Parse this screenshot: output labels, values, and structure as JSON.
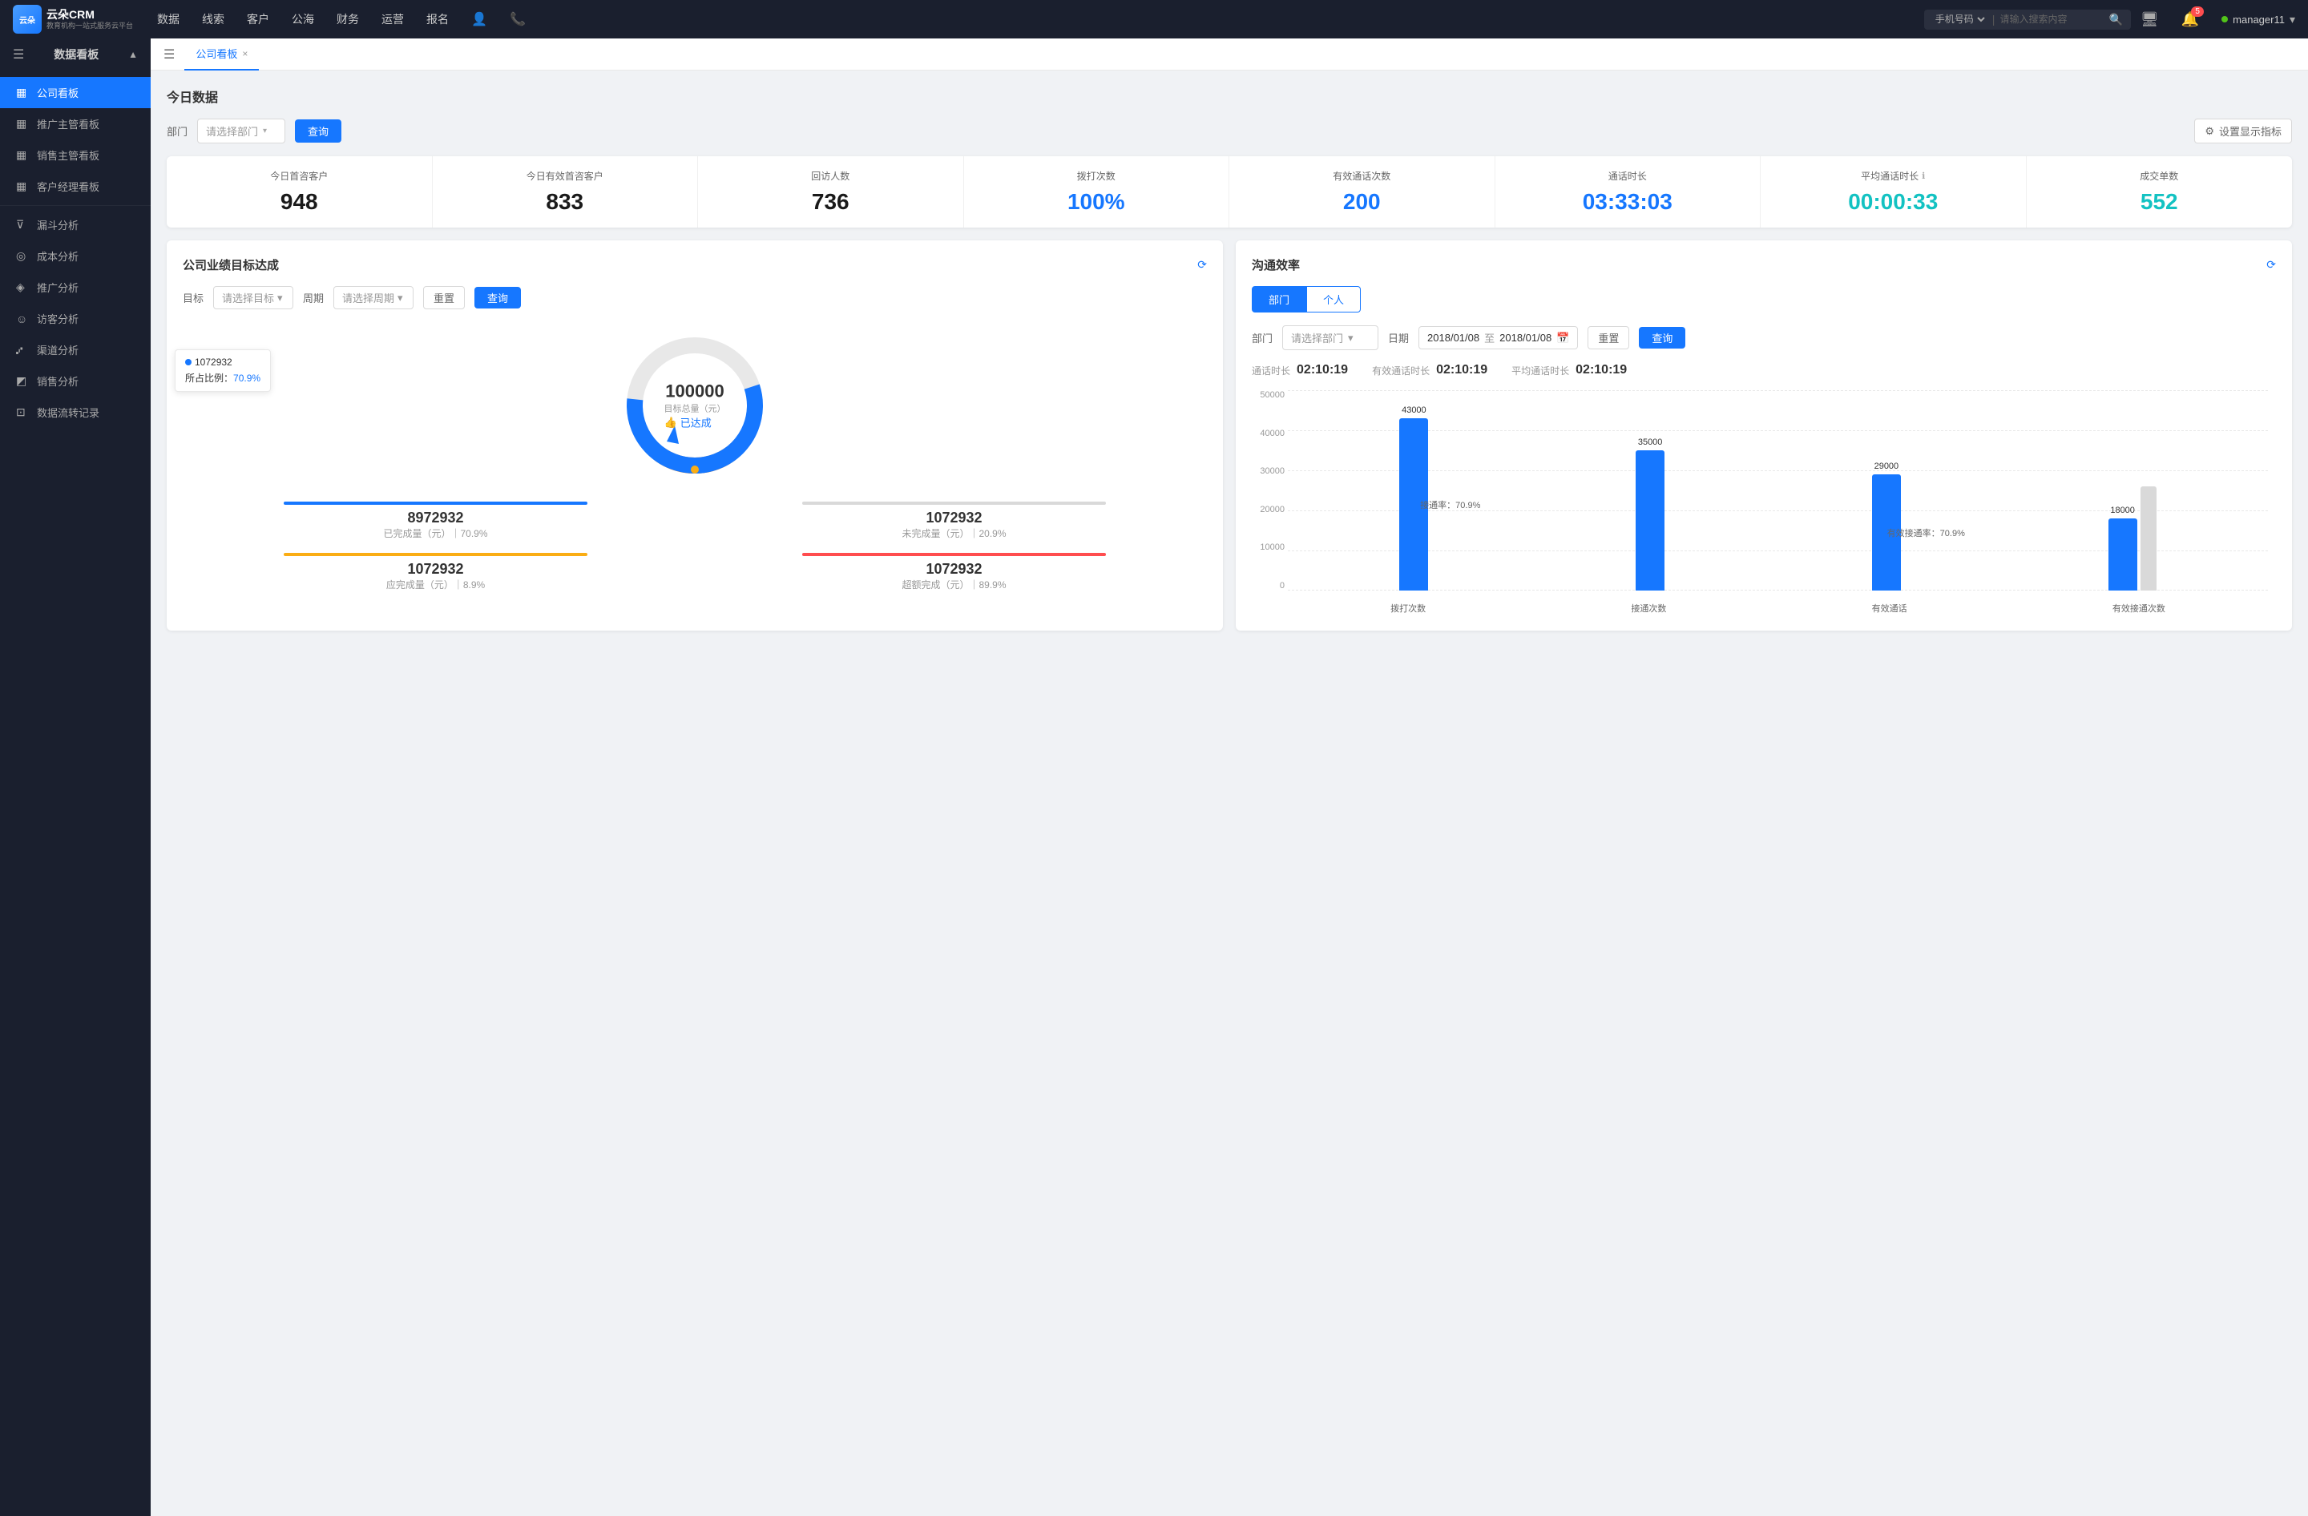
{
  "topNav": {
    "logo": {
      "brand": "云朵CRM",
      "subtitle": "教育机构一站式服务云平台"
    },
    "navItems": [
      "数据",
      "线索",
      "客户",
      "公海",
      "财务",
      "运营",
      "报名"
    ],
    "search": {
      "placeholder": "请输入搜索内容",
      "type": "手机号码"
    },
    "notificationCount": "5",
    "username": "manager11"
  },
  "sidebar": {
    "section": "数据看板",
    "items": [
      {
        "label": "公司看板",
        "active": true
      },
      {
        "label": "推广主管看板",
        "active": false
      },
      {
        "label": "销售主管看板",
        "active": false
      },
      {
        "label": "客户经理看板",
        "active": false
      },
      {
        "label": "漏斗分析",
        "active": false
      },
      {
        "label": "成本分析",
        "active": false
      },
      {
        "label": "推广分析",
        "active": false
      },
      {
        "label": "访客分析",
        "active": false
      },
      {
        "label": "渠道分析",
        "active": false
      },
      {
        "label": "销售分析",
        "active": false
      },
      {
        "label": "数据流转记录",
        "active": false
      }
    ]
  },
  "tab": {
    "label": "公司看板",
    "close": "×"
  },
  "today": {
    "title": "今日数据",
    "filter": {
      "label": "部门",
      "placeholder": "请选择部门",
      "queryBtn": "查询",
      "settingsBtn": "设置显示指标"
    },
    "stats": [
      {
        "label": "今日首咨客户",
        "value": "948",
        "color": "black"
      },
      {
        "label": "今日有效首咨客户",
        "value": "833",
        "color": "black"
      },
      {
        "label": "回访人数",
        "value": "736",
        "color": "black"
      },
      {
        "label": "拨打次数",
        "value": "100%",
        "color": "blue"
      },
      {
        "label": "有效通话次数",
        "value": "200",
        "color": "blue"
      },
      {
        "label": "通话时长",
        "value": "03:33:03",
        "color": "blue"
      },
      {
        "label": "平均通话时长",
        "value": "00:00:33",
        "color": "cyan"
      },
      {
        "label": "成交单数",
        "value": "552",
        "color": "cyan"
      }
    ]
  },
  "goalPanel": {
    "title": "公司业绩目标达成",
    "controls": {
      "targetLabel": "目标",
      "targetPlaceholder": "请选择目标",
      "periodLabel": "周期",
      "periodPlaceholder": "请选择周期",
      "resetBtn": "重置",
      "queryBtn": "查询"
    },
    "donut": {
      "value": "100000",
      "label": "目标总量（元）",
      "achieved": "已达成",
      "tooltip": {
        "title": "1072932",
        "percentLabel": "所占比例：",
        "percent": "70.9%"
      }
    },
    "stats": [
      {
        "label": "已完成量（元）",
        "sub": "70.9%",
        "value": "8972932",
        "barColor": "#1677ff"
      },
      {
        "label": "未完成量（元）",
        "sub": "20.9%",
        "value": "1072932",
        "barColor": "#d9d9d9"
      },
      {
        "label": "应完成量（元）",
        "sub": "8.9%",
        "value": "1072932",
        "barColor": "#faad14"
      },
      {
        "label": "超额完成（元）",
        "sub": "89.9%",
        "value": "1072932",
        "barColor": "#ff4d4f"
      }
    ]
  },
  "commPanel": {
    "title": "沟通效率",
    "tabs": [
      "部门",
      "个人"
    ],
    "activeTab": 0,
    "filters": {
      "deptLabel": "部门",
      "deptPlaceholder": "请选择部门",
      "dateLabel": "日期",
      "dateFrom": "2018/01/08",
      "dateTo": "2018/01/08",
      "resetBtn": "重置",
      "queryBtn": "查询"
    },
    "commStats": {
      "duration": {
        "label": "通话时长",
        "value": "02:10:19"
      },
      "effective": {
        "label": "有效通话时长",
        "value": "02:10:19"
      },
      "avg": {
        "label": "平均通话时长",
        "value": "02:10:19"
      }
    },
    "chart": {
      "yLabels": [
        "50000",
        "40000",
        "30000",
        "20000",
        "10000",
        "0"
      ],
      "xLabels": [
        "拨打次数",
        "接通次数",
        "有效通话",
        "有效接通次数"
      ],
      "bars": [
        {
          "label": "拨打次数",
          "value1": 43000,
          "label1": "43000",
          "rate": "接通率：70.9%"
        },
        {
          "label": "接通次数",
          "value1": 35000,
          "label1": "35000"
        },
        {
          "label": "有效通话",
          "value1": 29000,
          "label1": "29000",
          "rate": "有效接通率：70.9%"
        },
        {
          "label": "有效接通次数",
          "value1": 18000,
          "label1": "18000"
        }
      ],
      "maxValue": 50000
    }
  }
}
